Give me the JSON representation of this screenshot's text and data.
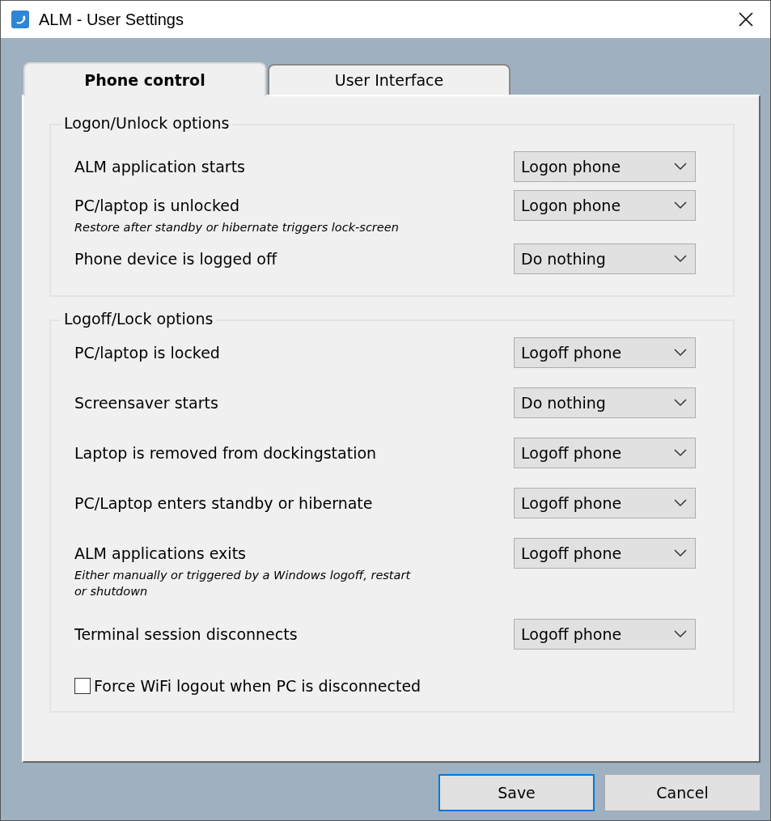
{
  "window": {
    "title": "ALM - User Settings"
  },
  "tabs": [
    {
      "label": "Phone control",
      "selected": true
    },
    {
      "label": "User Interface",
      "selected": false
    }
  ],
  "groups": [
    {
      "title": "Logon/Unlock options",
      "rows": [
        {
          "label": "ALM application starts",
          "value": "Logon phone"
        },
        {
          "label": "PC/laptop is unlocked",
          "note": "Restore after standby or hibernate triggers lock-screen",
          "value": "Logon phone"
        },
        {
          "label": "Phone device is logged off",
          "value": "Do nothing"
        }
      ]
    },
    {
      "title": "Logoff/Lock options",
      "rows": [
        {
          "label": "PC/laptop is locked",
          "value": "Logoff phone"
        },
        {
          "label": "Screensaver starts",
          "value": "Do nothing"
        },
        {
          "label": "Laptop is removed from dockingstation",
          "value": "Logoff phone"
        },
        {
          "label": "PC/Laptop enters standby or hibernate",
          "value": "Logoff phone"
        },
        {
          "label": "ALM applications exits",
          "note": "Either manually or triggered by a Windows logoff, restart or shutdown",
          "value": "Logoff phone"
        },
        {
          "label": "Terminal session disconnects",
          "value": "Logoff phone"
        }
      ],
      "checkbox": {
        "label": "Force WiFi logout when PC is disconnected",
        "checked": false
      }
    }
  ],
  "buttons": [
    {
      "label": "Save",
      "default": true
    },
    {
      "label": "Cancel",
      "default": false
    }
  ]
}
